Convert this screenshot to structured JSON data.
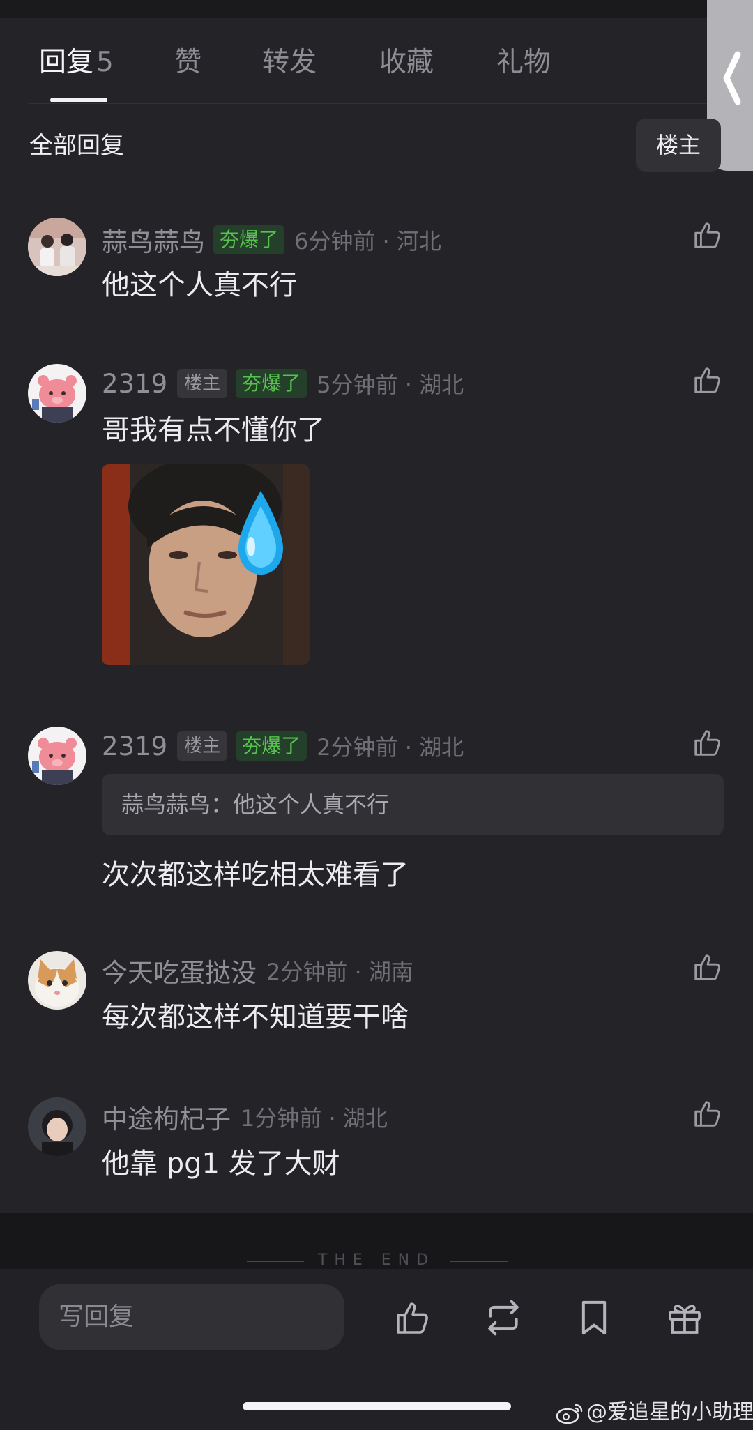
{
  "tabs": [
    {
      "label": "回复",
      "count": "5"
    },
    {
      "label": "赞"
    },
    {
      "label": "转发"
    },
    {
      "label": "收藏"
    },
    {
      "label": "礼物"
    }
  ],
  "section_title": "全部回复",
  "op_filter_label": "楼主",
  "hot_badge": "夯爆了",
  "op_badge": "楼主",
  "comments": [
    {
      "name": "蒜鸟蒜鸟",
      "time": "6分钟前 · 河北",
      "text": "他这个人真不行"
    },
    {
      "name": "2319",
      "time": "5分钟前 · 湖北",
      "text": "哥我有点不懂你了"
    },
    {
      "name": "2319",
      "time": "2分钟前 · 湖北",
      "quote": "蒜鸟蒜鸟：他这个人真不行",
      "text": "次次都这样吃相太难看了"
    },
    {
      "name": "今天吃蛋挞没",
      "time": "2分钟前 · 湖南",
      "text": "每次都这样不知道要干啥"
    },
    {
      "name": "中途枸杞子",
      "time": "1分钟前 · 湖北",
      "text": "他靠 pg1 发了大财"
    }
  ],
  "end_text": "THE END",
  "reply_placeholder": "写回复",
  "watermark": "@爱追星的小助理",
  "colors": {
    "hot_badge_text": "#58c24f",
    "background": "#242428"
  }
}
